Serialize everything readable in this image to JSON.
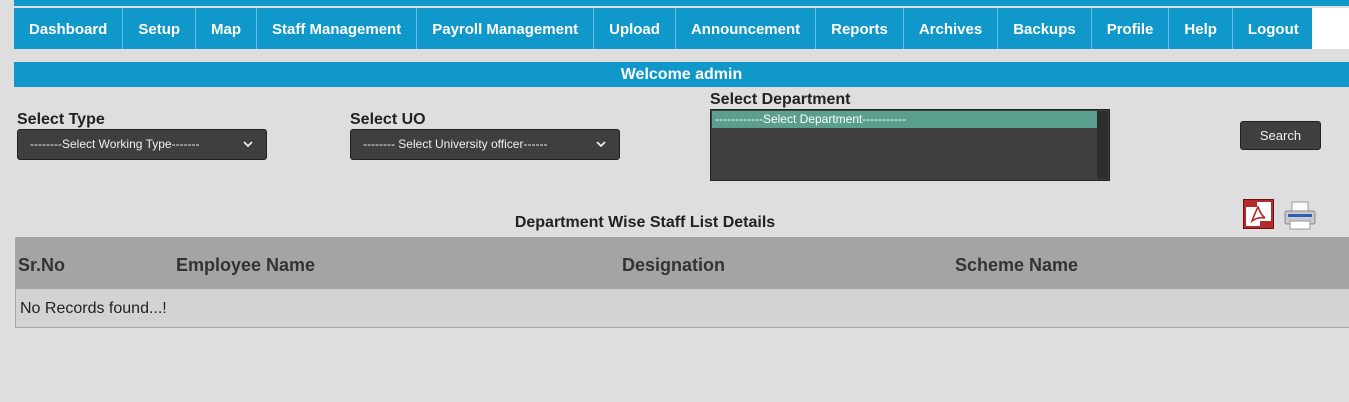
{
  "nav": {
    "items": [
      {
        "label": "Dashboard"
      },
      {
        "label": "Setup"
      },
      {
        "label": "Map"
      },
      {
        "label": "Staff Management"
      },
      {
        "label": "Payroll Management"
      },
      {
        "label": "Upload"
      },
      {
        "label": "Announcement"
      },
      {
        "label": "Reports"
      },
      {
        "label": "Archives"
      },
      {
        "label": "Backups"
      },
      {
        "label": "Profile"
      },
      {
        "label": "Help"
      },
      {
        "label": "Logout"
      }
    ]
  },
  "welcome": "Welcome admin",
  "filters": {
    "type": {
      "label": "Select Type",
      "value": "--------Select Working Type-------"
    },
    "uo": {
      "label": "Select UO",
      "value": "-------- Select University officer------"
    },
    "department": {
      "label": "Select Department",
      "options": [
        "------------Select Department-----------"
      ]
    },
    "search_label": "Search"
  },
  "list": {
    "title": "Department Wise Staff List Details",
    "columns": [
      "Sr.No",
      "Employee Name",
      "Designation",
      "Scheme Name"
    ],
    "empty_message": "No Records found...!"
  },
  "colors": {
    "accent": "#0f98c9",
    "header_bg": "#a4a4a4",
    "row_bg": "#d3d3d3",
    "control_bg": "#3f3f3f"
  }
}
